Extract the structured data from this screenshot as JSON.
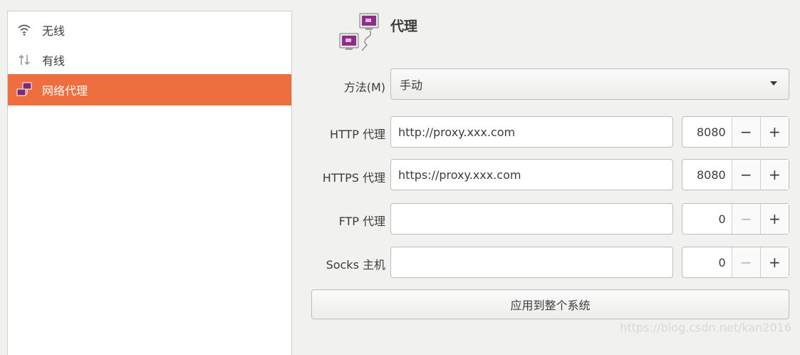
{
  "sidebar": {
    "items": [
      {
        "label": "无线",
        "icon": "wifi-icon"
      },
      {
        "label": "有线",
        "icon": "wired-arrows-icon"
      },
      {
        "label": "网络代理",
        "icon": "network-proxy-icon",
        "selected": true
      }
    ]
  },
  "header": {
    "title": "代理",
    "icon": "proxy-monitors-icon"
  },
  "form": {
    "method": {
      "label": "方法(M)",
      "value": "手动"
    },
    "http": {
      "label": "HTTP 代理",
      "value": "http://proxy.xxx.com",
      "port": "8080"
    },
    "https": {
      "label": "HTTPS 代理",
      "value": "https://proxy.xxx.com",
      "port": "8080"
    },
    "ftp": {
      "label": "FTP 代理",
      "value": "",
      "port": "0"
    },
    "socks": {
      "label": "Socks 主机",
      "value": "",
      "port": "0"
    },
    "minus": "−",
    "plus": "+"
  },
  "apply_label": "应用到整个系统",
  "watermark": "https://blog.csdn.net/kan2016",
  "colors": {
    "accent": "#ee6e3f"
  }
}
